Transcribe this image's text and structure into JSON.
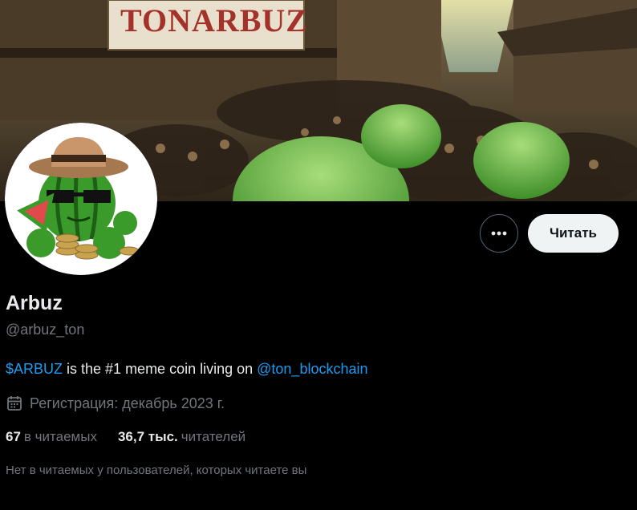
{
  "banner": {
    "sign_text": "TONARBUZ",
    "sign_subtext": "Ᏼ",
    "colors": {
      "sky": "#c9d6c4",
      "street": "#5b4a32",
      "melon": "#6bbd4a"
    }
  },
  "avatar": {
    "description_icon": "watermelon-mascot-icon",
    "colors": {
      "melon": "#3a9a2a",
      "hat": "#c9966b",
      "ring": "#000000"
    }
  },
  "actions": {
    "more_icon": "more-horizontal-icon",
    "follow_label": "Читать"
  },
  "profile": {
    "display_name": "Arbuz",
    "handle": "@arbuz_ton",
    "bio": {
      "cashtag": "$ARBUZ",
      "middle": " is the #1 meme coin living on ",
      "mention": "@ton_blockchain"
    },
    "joined_icon": "calendar-icon",
    "joined": "Регистрация: декабрь 2023 г.",
    "stats": {
      "following_count": "67",
      "following_label": "в читаемых",
      "followers_count": "36,7 тыс.",
      "followers_label": "читателей"
    },
    "followers_note": "Нет в читаемых у пользователей, которых читаете вы"
  },
  "colors": {
    "background": "#000000",
    "text_primary": "#e7e9ea",
    "text_secondary": "#71767b",
    "link": "#1d9bf0",
    "button_bg": "#eff3f4"
  }
}
